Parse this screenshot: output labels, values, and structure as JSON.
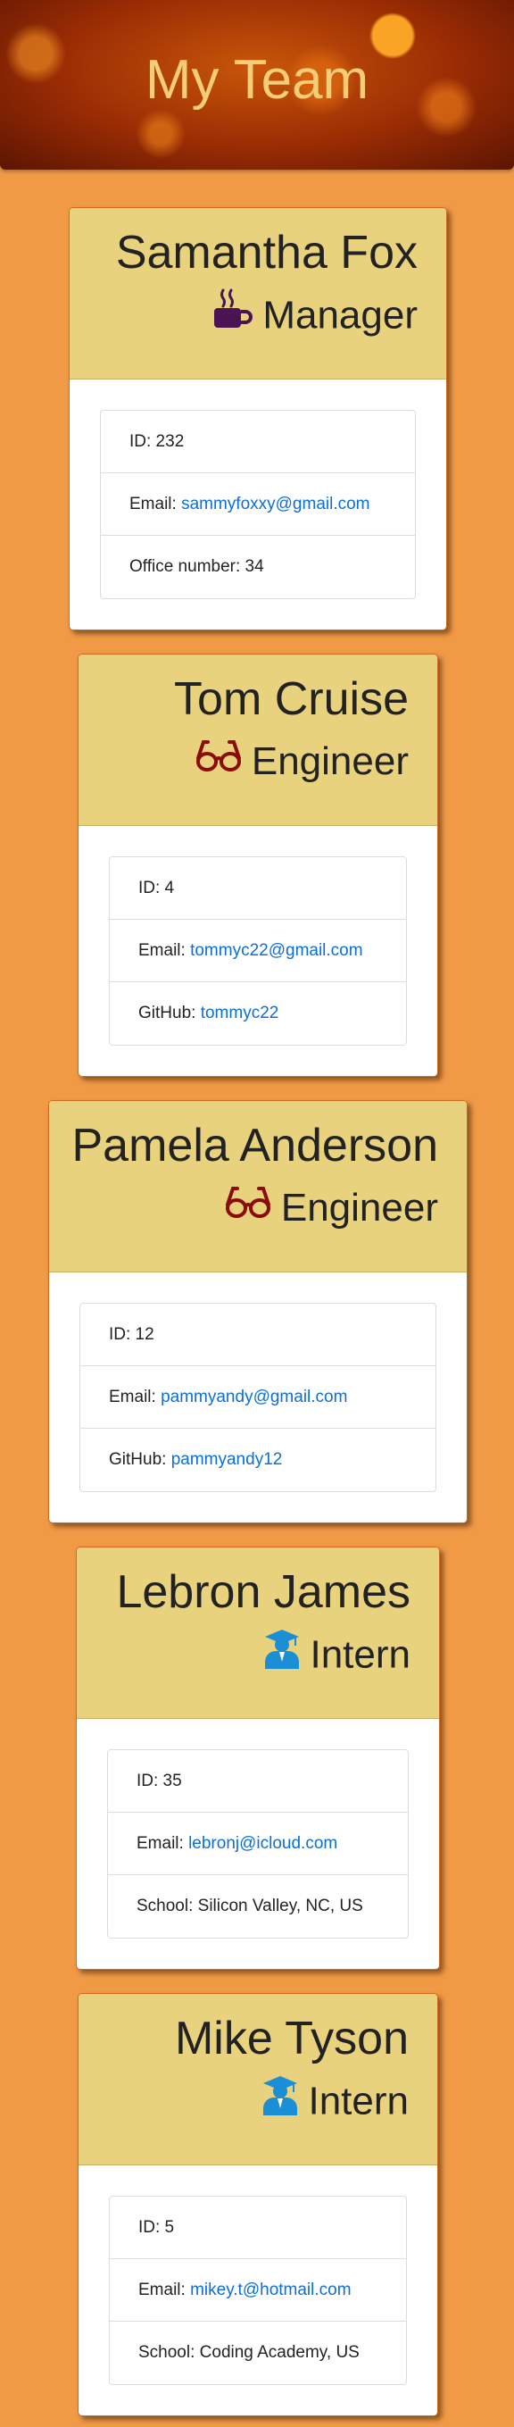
{
  "page": {
    "title": "My Team"
  },
  "colors": {
    "background": "#f19a46",
    "card_header": "#e9d27d",
    "link": "#0b6fd6",
    "manager_icon": "#4a1454",
    "engineer_icon": "#8b0c0c",
    "intern_icon": "#1b8fd6"
  },
  "team": [
    {
      "name": "Samantha Fox",
      "role": "Manager",
      "icon": "coffee-mug-icon",
      "id_label": "ID: 232",
      "email_label": "Email: ",
      "email": "sammyfoxxy@gmail.com",
      "extra_label": "Office number: 34",
      "extra_link": ""
    },
    {
      "name": "Tom Cruise",
      "role": "Engineer",
      "icon": "glasses-icon",
      "id_label": "ID: 4",
      "email_label": "Email: ",
      "email": "tommyc22@gmail.com",
      "extra_label": "GitHub: ",
      "extra_link": "tommyc22"
    },
    {
      "name": "Pamela Anderson",
      "role": "Engineer",
      "icon": "glasses-icon",
      "id_label": "ID: 12",
      "email_label": "Email: ",
      "email": "pammyandy@gmail.com",
      "extra_label": "GitHub: ",
      "extra_link": "pammyandy12"
    },
    {
      "name": "Lebron James",
      "role": "Intern",
      "icon": "graduate-icon",
      "id_label": "ID: 35",
      "email_label": "Email: ",
      "email": "lebronj@icloud.com",
      "extra_label": "School: Silicon Valley, NC, US",
      "extra_link": ""
    },
    {
      "name": "Mike Tyson",
      "role": "Intern",
      "icon": "graduate-icon",
      "id_label": "ID: 5",
      "email_label": "Email: ",
      "email": "mikey.t@hotmail.com",
      "extra_label": "School: Coding Academy, US",
      "extra_link": ""
    }
  ]
}
